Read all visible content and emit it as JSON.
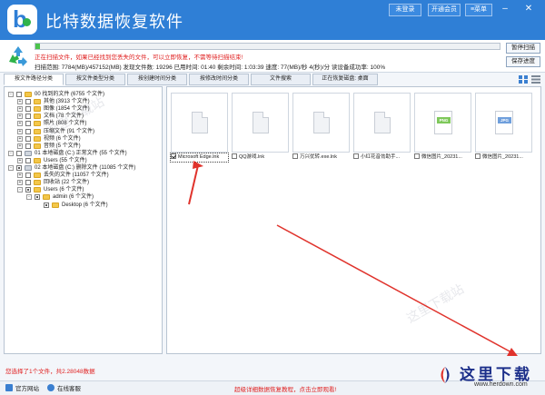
{
  "app": {
    "title": "比特数据恢复软件",
    "logo_letter": "b"
  },
  "titlebar": {
    "login": "未登录",
    "vip": "开通会员",
    "menu": "菜单"
  },
  "status": {
    "progress_fraction": 0.01,
    "message": "正在扫描文件，如果已经找到您丢失的文件，可以立即恢复，不需等待扫描结束!",
    "info": "扫描范围: 7784(MB)/457152(MB)    发现文件数: 19296    已用时间: 01:40    剩余时间: 1:03:39    速度: 77(MB)/秒    4(秒)/分    读设备成功率: 100%",
    "pause_button": "暂停扫描",
    "save_button": "保存进度"
  },
  "tabs": [
    {
      "label": "按文件路径分类",
      "active": true
    },
    {
      "label": "按文件类型分类",
      "active": false
    },
    {
      "label": "按创建时间分类",
      "active": false
    },
    {
      "label": "按修改时间分类",
      "active": false
    },
    {
      "label": "文件搜索",
      "active": false
    },
    {
      "label": "正在恢复磁盘: 桌面",
      "active": false
    }
  ],
  "tree": [
    {
      "label": "00 找到的文件  (6755 个文件)",
      "level": 0,
      "exp": "-",
      "check": "none",
      "icon": "folder"
    },
    {
      "label": "其他  (3913 个文件)",
      "level": 1,
      "exp": "+",
      "check": "none",
      "icon": "folder"
    },
    {
      "label": "图像  (1854 个文件)",
      "level": 1,
      "exp": "+",
      "check": "none",
      "icon": "folder"
    },
    {
      "label": "文档  (78 个文件)",
      "level": 1,
      "exp": "+",
      "check": "none",
      "icon": "folder"
    },
    {
      "label": "照片  (808 个文件)",
      "level": 1,
      "exp": "+",
      "check": "none",
      "icon": "folder"
    },
    {
      "label": "压缩文件  (91 个文件)",
      "level": 1,
      "exp": "+",
      "check": "none",
      "icon": "folder"
    },
    {
      "label": "视频  (6 个文件)",
      "level": 1,
      "exp": "+",
      "check": "none",
      "icon": "folder"
    },
    {
      "label": "音频  (5 个文件)",
      "level": 1,
      "exp": "+",
      "check": "none",
      "icon": "folder"
    },
    {
      "label": "01 本地磁盘 (C:) 正常文件  (55 个文件)",
      "level": 0,
      "exp": "-",
      "check": "none",
      "icon": "drive"
    },
    {
      "label": "Users  (55 个文件)",
      "level": 1,
      "exp": "+",
      "check": "none",
      "icon": "folder"
    },
    {
      "label": "02 本地磁盘 (C:) 删除文件  (11085 个文件)",
      "level": 0,
      "exp": "-",
      "check": "partial",
      "icon": "drive"
    },
    {
      "label": "丢失的文件  (11057 个文件)",
      "level": 1,
      "exp": "+",
      "check": "none",
      "icon": "folder"
    },
    {
      "label": "回收站  (22 个文件)",
      "level": 1,
      "exp": "+",
      "check": "none",
      "icon": "folder"
    },
    {
      "label": "Users  (6 个文件)",
      "level": 1,
      "exp": "-",
      "check": "partial",
      "icon": "folder"
    },
    {
      "label": "admin  (6 个文件)",
      "level": 2,
      "exp": "-",
      "check": "partial",
      "icon": "folder"
    },
    {
      "label": "Desktop  (6 个文件)",
      "level": 3,
      "exp": "",
      "check": "partial",
      "icon": "folder"
    }
  ],
  "files": [
    {
      "name": "Microsoft Edge.lnk",
      "checked": true,
      "selected": true,
      "type": "doc"
    },
    {
      "name": "QQ游戏.lnk",
      "checked": false,
      "selected": false,
      "type": "doc"
    },
    {
      "name": "万兴优转.exe.lnk",
      "checked": false,
      "selected": false,
      "type": "doc"
    },
    {
      "name": "小红花音効助手...",
      "checked": false,
      "selected": false,
      "type": "doc"
    },
    {
      "name": "微信图片_20231...",
      "checked": false,
      "selected": false,
      "type": "png",
      "badge": "PNG",
      "color": "#7ec85a"
    },
    {
      "name": "微信图片_20231...",
      "checked": false,
      "selected": false,
      "type": "jpg",
      "badge": "JPG",
      "color": "#6f9fdc"
    }
  ],
  "bottom": {
    "selection_summary": "您选择了1个文件，共2.28048数据",
    "website": "官方网站",
    "online_service": "在线客服",
    "tutorial": "超级详细数据恢复教程，点击立即观看!"
  },
  "brand": {
    "name": "这里下载",
    "url": "www.herdown.com"
  },
  "watermarks": [
    "这里下载站",
    "这里下载站"
  ],
  "colors": {
    "titlebar": "#2f7fd6",
    "alert": "#e02020",
    "progress": "#4cc34c"
  }
}
